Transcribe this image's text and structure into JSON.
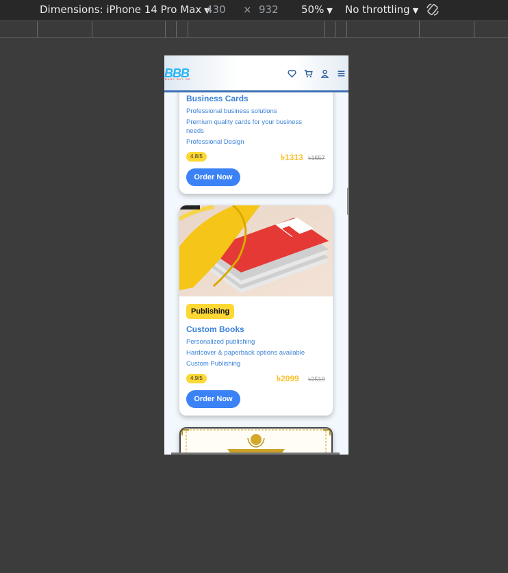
{
  "devtools": {
    "dimensions_label": "Dimensions: iPhone 14 Pro Max",
    "width": "430",
    "times": "×",
    "height": "932",
    "zoom": "50%",
    "throttling": "No throttling"
  },
  "site": {
    "logo_text": "BBB",
    "logo_sub": "BANK BUY BD"
  },
  "cards": [
    {
      "title": "Business Cards",
      "lines": [
        "Professional business solutions",
        "Premium quality cards for your business",
        "needs",
        "Professional Design"
      ],
      "rating": "4.8/5",
      "price": "৳1313",
      "old_price": "৳1557",
      "button": "Order Now"
    },
    {
      "badge": "Publishing",
      "title": "Custom Books",
      "lines": [
        "Personalized publishing",
        "Hardcover & paperback options available",
        "Custom Publishing"
      ],
      "rating": "4.9/5",
      "price": "৳2099",
      "old_price": "৳2519",
      "button": "Order Now"
    }
  ],
  "colors": {
    "accent": "#3b82f6",
    "title_blue": "#3b82d8",
    "badge_yellow": "#fdd835",
    "price_yellow": "#fbc02d",
    "header_border": "#3b6fb4"
  },
  "icons": [
    "heart-icon",
    "cart-icon",
    "user-icon",
    "menu-icon",
    "rotate-icon"
  ]
}
